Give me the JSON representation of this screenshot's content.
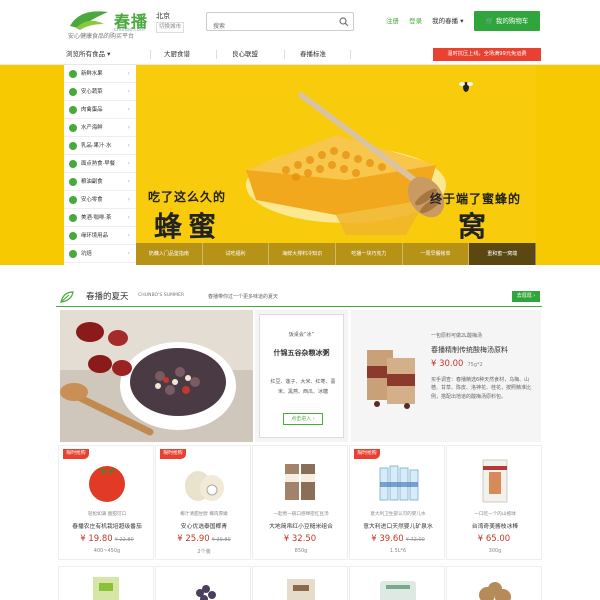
{
  "header": {
    "logo_text": "春播",
    "logo_domain": "chunbo.com",
    "slogan": "安心健康食品的购买平台",
    "city": "北京",
    "city_switch": "切换城市",
    "search_placeholder": "搜索",
    "links": {
      "register": "注册",
      "login": "登录",
      "my": "我的春播 ▾"
    },
    "cart_label": "我的购物车",
    "brand_color": "#30a53c"
  },
  "nav": {
    "all_label": "浏览所有食品 ▾",
    "items": [
      "大厨食谱",
      "良心联盟",
      "春播标准"
    ],
    "promo": "温时抗压上线，全场满99元免运费"
  },
  "categories": [
    {
      "label": "新鲜水果",
      "icon": "fruit-icon"
    },
    {
      "label": "安心蔬菜",
      "icon": "vegetable-icon"
    },
    {
      "label": "肉禽蛋品",
      "icon": "meat-icon"
    },
    {
      "label": "水产海鲜",
      "icon": "seafood-icon"
    },
    {
      "label": "乳品·果汁·水",
      "icon": "milk-icon"
    },
    {
      "label": "面点熟食·早餐",
      "icon": "bread-icon"
    },
    {
      "label": "粮油副食",
      "icon": "grain-icon"
    },
    {
      "label": "安心零食",
      "icon": "snack-icon"
    },
    {
      "label": "美酒·咖啡·茶",
      "icon": "wine-icon"
    },
    {
      "label": "缘环境用品",
      "icon": "home-icon"
    },
    {
      "label": "坑焙",
      "icon": "bakery-icon"
    }
  ],
  "banner": {
    "left_line1": "吃了这么久的",
    "left_line2": "蜂蜜",
    "right_line1": "终于端了蜜蜂的",
    "right_line2": "窝",
    "tabs": [
      "奶藕入门品鉴指南",
      "试吃福利",
      "海鲜大排料冷知识",
      "吃播一块巧克力",
      "一周早餐帐单",
      "重和蜜一窝端"
    ],
    "active_tab": 5
  },
  "section": {
    "title": "春播的夏天",
    "subtitle_en": "CHUNBO'S SUMMER",
    "desc": "春播带你过一个更多味道的夏天",
    "more": "去逛逛 ›"
  },
  "feature_card": {
    "small": "饭桌会“冰”",
    "title": "什锦五谷杂粮冰粥",
    "desc": "红豆、莲子、大米、红枣、薏米、黑燕、西瓜、冰糖",
    "button": "点击进入 ›"
  },
  "feature_product": {
    "tag": "一包原料可做2L酸梅汤",
    "title": "春播精制传统酸梅汤原料",
    "price": "¥ 30.00",
    "weight": "75g*2",
    "desc": "买手调查：春播精选6种天然食材，乌梅、山楂、甘草、陈皮、洛神花、桂花，按照精准比例，搭配出地道的酸梅汤原料包。"
  },
  "products": [
    {
      "badge": "限时抢购",
      "desc": "轻松如满 酸甜可口",
      "name": "春播农庄有机栽培超级番茄",
      "price": "¥ 19.80",
      "old": "¥ 22.80",
      "weight": "400~450g",
      "icon": "tomato-icon"
    },
    {
      "badge": "限时抢购",
      "desc": "椰汁清甜甘醇 椰肉厚嫩",
      "name": "安心优选泰国椰青",
      "price": "¥ 25.90",
      "old": "¥ 39.80",
      "weight": "2个装",
      "icon": "coconut-icon"
    },
    {
      "badge": "",
      "desc": "一起煮一锅口感绵密红豆汤",
      "name": "大地简帛红小豆糙米组合",
      "price": "¥ 32.50",
      "old": "",
      "weight": "850g",
      "icon": "beans-icon"
    },
    {
      "badge": "限时抢购",
      "desc": "意大利卫生部认可的婴儿水",
      "name": "意大利进口天然婴儿矿泉水",
      "price": "¥ 39.60",
      "old": "¥ 72.00",
      "weight": "1.5L*6",
      "icon": "water-icon"
    },
    {
      "badge": "",
      "desc": "一口吃一个的山楂球",
      "name": "台湾奇美酱枝冰棒",
      "price": "¥ 65.00",
      "old": "",
      "weight": "300g",
      "icon": "popsicle-icon"
    }
  ]
}
